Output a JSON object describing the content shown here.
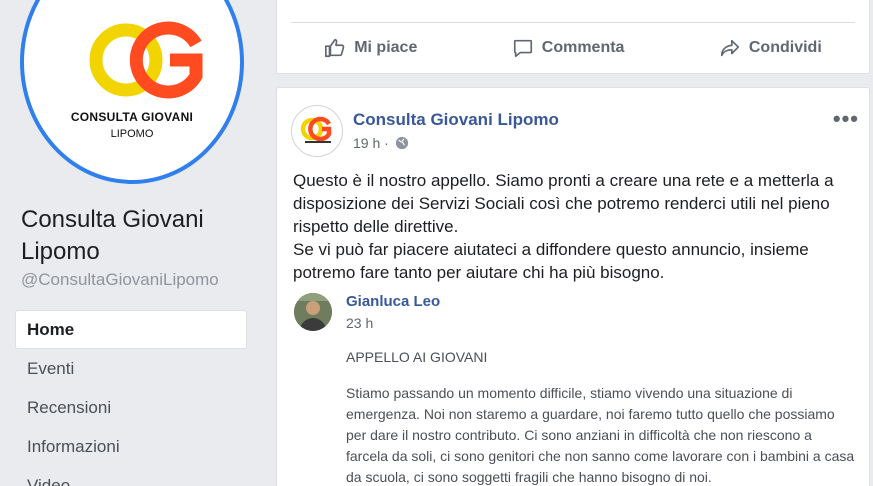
{
  "page": {
    "logo_text": "CONSULTA GIOVANI",
    "logo_sub": "LIPOMO",
    "name": "Consulta Giovani Lipomo",
    "handle": "@ConsultaGiovaniLipomo",
    "colors": {
      "accent_blue": "#2f80ed",
      "logo_yellow": "#f2d400",
      "logo_orange": "#ff4b1f",
      "link_blue": "#385898"
    }
  },
  "nav": {
    "items": [
      {
        "label": "Home"
      },
      {
        "label": "Eventi"
      },
      {
        "label": "Recensioni"
      },
      {
        "label": "Informazioni"
      },
      {
        "label": "Video"
      }
    ]
  },
  "top_card": {
    "like_label": "Mi piace",
    "comment_label": "Commenta",
    "share_label": "Condividi"
  },
  "post": {
    "author": "Consulta Giovani Lipomo",
    "time": "19 h ·",
    "more_label": "•••",
    "text_line1": "Questo è il nostro appello. Siamo pronti a creare una rete e a metterla a disposizione dei Servizi Sociali così che potremo renderci utili nel pieno rispetto delle direttive.",
    "text_line2": "Se vi può far piacere aiutateci a diffondere questo annuncio, insieme potremo fare tanto per aiutare chi ha più bisogno.",
    "shared": {
      "author": "Gianluca Leo",
      "time": "23 h",
      "title": "APPELLO AI GIOVANI",
      "body": "Stiamo passando un momento difficile, stiamo vivendo una situazione di emergenza. Noi non staremo a guardare, noi faremo tutto quello che possiamo per dare il nostro contributo. Ci sono anziani in difficoltà che non riescono a farcela da soli, ci sono genitori che non sanno come lavorare con i bambini a casa da scuola, ci sono soggetti fragili che hanno bisogno di noi."
    }
  }
}
